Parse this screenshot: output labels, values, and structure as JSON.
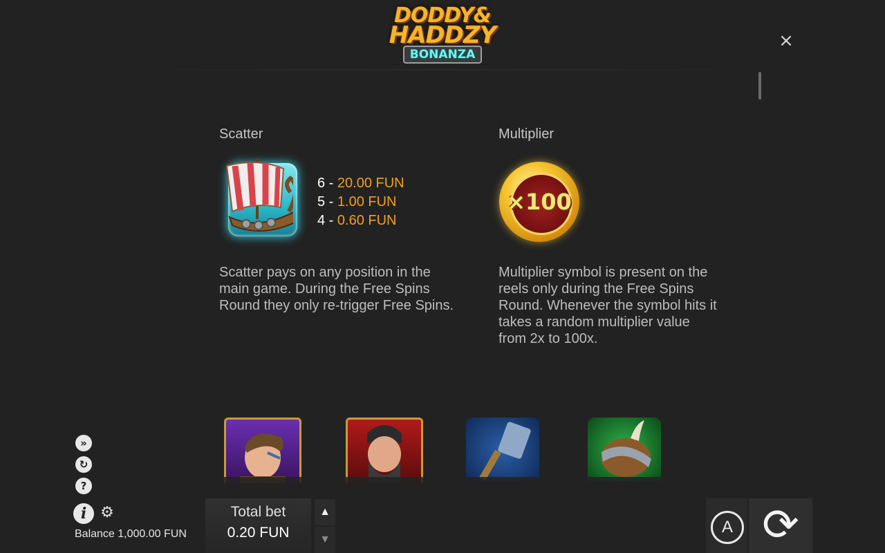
{
  "logo": {
    "line1": "DODDY&",
    "line2": "HADDZY",
    "line3": "BONANZA"
  },
  "close_icon": "×",
  "scatter": {
    "title": "Scatter",
    "icon": "viking-ship-scatter-symbol",
    "pays": [
      {
        "count": "6 -",
        "value": "20.00 FUN"
      },
      {
        "count": "5 -",
        "value": "1.00 FUN"
      },
      {
        "count": "4 -",
        "value": "0.60 FUN"
      }
    ],
    "description": "Scatter pays on any position in the main game. During the Free Spins Round they only re-trigger Free Spins."
  },
  "multiplier": {
    "title": "Multiplier",
    "icon": "gold-coin-multiplier-symbol",
    "coin_text": "×100",
    "description": "Multiplier symbol is present on the reels only during the Free Spins Round. Whenever the symbol hits it takes a random multiplier value from 2x to 100x."
  },
  "side_icons": {
    "turbo": "»",
    "history": "↻",
    "help": "?",
    "info": "i",
    "settings": "⚙"
  },
  "balance": "Balance 1,000.00 FUN",
  "bet": {
    "label": "Total bet",
    "value": "0.20 FUN",
    "up": "▲",
    "down": "▼"
  },
  "autoplay_label": "A",
  "spin_glyph": "⟳",
  "colors": {
    "background": "#222222",
    "accent": "#f0a020",
    "text": "#bdbdbd"
  }
}
